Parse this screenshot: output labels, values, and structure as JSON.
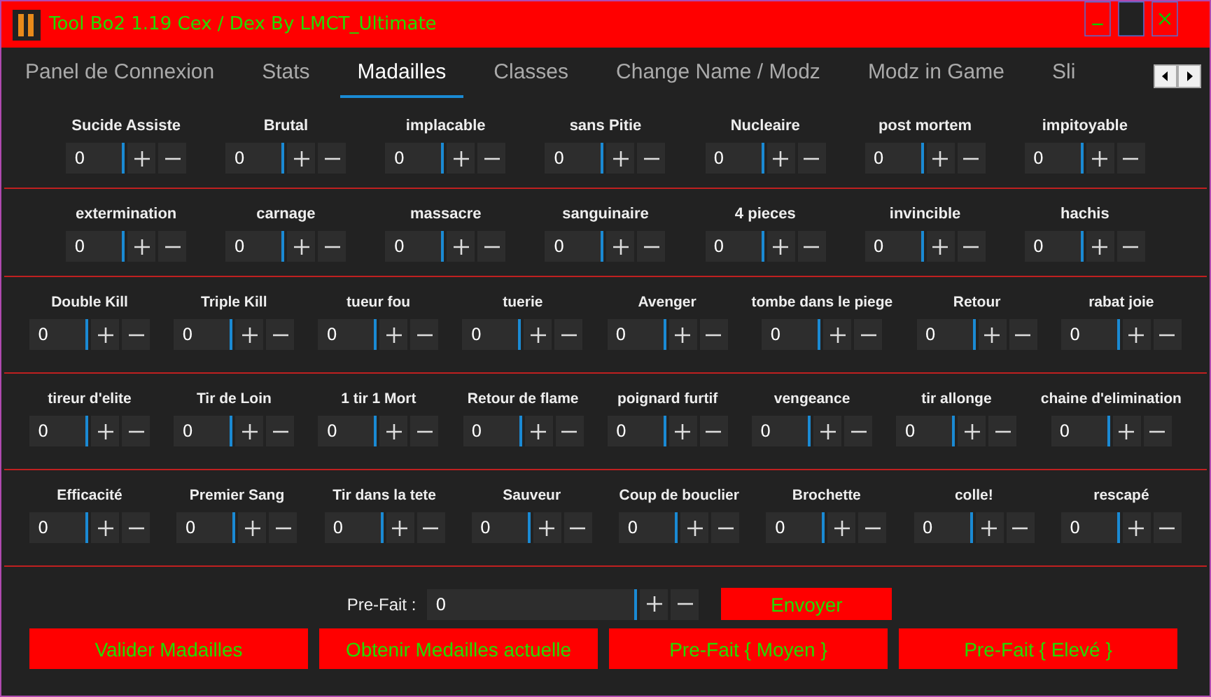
{
  "window": {
    "title": "Tool Bo2 1.19 Cex / Dex By LMCT_Ultimate"
  },
  "tabs": [
    {
      "label": "Panel de Connexion",
      "selected": false
    },
    {
      "label": "Stats",
      "selected": false
    },
    {
      "label": "Madailles",
      "selected": true
    },
    {
      "label": "Classes",
      "selected": false
    },
    {
      "label": "Change Name / Modz",
      "selected": false
    },
    {
      "label": "Modz in Game",
      "selected": false
    },
    {
      "label": "Sli",
      "selected": false
    }
  ],
  "sections": [
    [
      {
        "label": "Sucide Assiste",
        "value": "0"
      },
      {
        "label": "Brutal",
        "value": "0"
      },
      {
        "label": "implacable",
        "value": "0"
      },
      {
        "label": "sans Pitie",
        "value": "0"
      },
      {
        "label": "Nucleaire",
        "value": "0"
      },
      {
        "label": "post mortem",
        "value": "0"
      },
      {
        "label": "impitoyable",
        "value": "0"
      }
    ],
    [
      {
        "label": "extermination",
        "value": "0"
      },
      {
        "label": "carnage",
        "value": "0"
      },
      {
        "label": "massacre",
        "value": "0"
      },
      {
        "label": "sanguinaire",
        "value": "0"
      },
      {
        "label": "4 pieces",
        "value": "0"
      },
      {
        "label": "invincible",
        "value": "0"
      },
      {
        "label": "hachis",
        "value": "0"
      }
    ],
    [
      {
        "label": "Double Kill",
        "value": "0"
      },
      {
        "label": "Triple Kill",
        "value": "0"
      },
      {
        "label": "tueur fou",
        "value": "0"
      },
      {
        "label": "tuerie",
        "value": "0"
      },
      {
        "label": "Avenger",
        "value": "0"
      },
      {
        "label": "tombe dans le piege",
        "value": "0"
      },
      {
        "label": "Retour",
        "value": "0"
      },
      {
        "label": "rabat joie",
        "value": "0"
      }
    ],
    [
      {
        "label": "tireur d'elite",
        "value": "0"
      },
      {
        "label": "Tir de Loin",
        "value": "0"
      },
      {
        "label": "1 tir 1 Mort",
        "value": "0"
      },
      {
        "label": "Retour de flame",
        "value": "0"
      },
      {
        "label": "poignard furtif",
        "value": "0"
      },
      {
        "label": "vengeance",
        "value": "0"
      },
      {
        "label": "tir allonge",
        "value": "0"
      },
      {
        "label": "chaine d'elimination",
        "value": "0"
      }
    ],
    [
      {
        "label": "Efficacité",
        "value": "0"
      },
      {
        "label": "Premier Sang",
        "value": "0"
      },
      {
        "label": "Tir dans la tete",
        "value": "0"
      },
      {
        "label": "Sauveur",
        "value": "0"
      },
      {
        "label": "Coup de bouclier",
        "value": "0"
      },
      {
        "label": "Brochette",
        "value": "0"
      },
      {
        "label": "colle!",
        "value": "0"
      },
      {
        "label": "rescapé",
        "value": "0"
      }
    ]
  ],
  "prefait": {
    "label": "Pre-Fait :",
    "value": "0",
    "button": "Envoyer"
  },
  "buttons": [
    "Valider Madailles",
    "Obtenir Medailles actuelle",
    "Pre-Fait { Moyen }",
    "Pre-Fait { Elevé }"
  ]
}
